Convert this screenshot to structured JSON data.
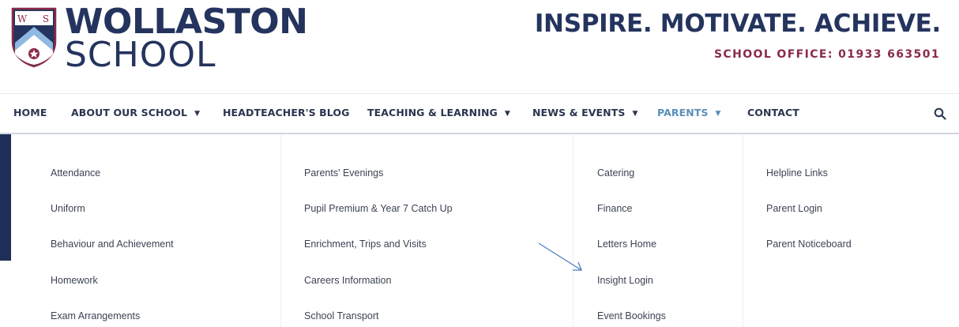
{
  "brand": {
    "crest_letters": [
      "W",
      "S"
    ],
    "name_line1": "WOLLASTON",
    "name_line2": "SCHOOL",
    "tagline": "INSPIRE. MOTIVATE. ACHIEVE.",
    "office": "SCHOOL OFFICE: 01933 663501",
    "colors": {
      "navy": "#24345e",
      "maroon": "#8a2b48",
      "sky": "#8fb9e3",
      "active": "#5a8fb8"
    }
  },
  "nav": {
    "items": [
      {
        "label": "HOME",
        "dropdown": false
      },
      {
        "label": "ABOUT OUR SCHOOL",
        "dropdown": true
      },
      {
        "label": "HEADTEACHER'S BLOG",
        "dropdown": false
      },
      {
        "label": "TEACHING & LEARNING",
        "dropdown": true
      },
      {
        "label": "NEWS & EVENTS",
        "dropdown": true
      },
      {
        "label": "PARENTS",
        "dropdown": true,
        "active": true
      },
      {
        "label": "CONTACT",
        "dropdown": false
      }
    ],
    "caret": "▼",
    "search_icon": "search-icon"
  },
  "mega_menu": {
    "columns": [
      [
        "Attendance",
        "Uniform",
        "Behaviour and Achievement",
        "Homework",
        "Exam Arrangements"
      ],
      [
        "Parents' Evenings",
        "Pupil Premium & Year 7 Catch Up",
        "Enrichment, Trips and Visits",
        "Careers Information",
        "School Transport"
      ],
      [
        "Catering",
        "Finance",
        "Letters Home",
        "Insight Login",
        "Event Bookings"
      ],
      [
        "Helpline Links",
        "Parent Login",
        "Parent Noticeboard"
      ]
    ]
  }
}
